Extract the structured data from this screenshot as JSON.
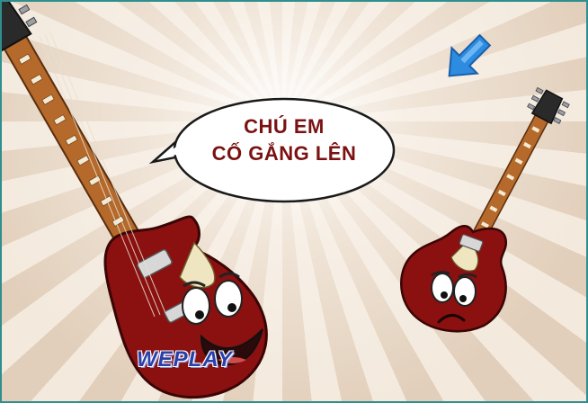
{
  "speech_bubble": {
    "line1": "CHÚ EM",
    "line2": "CỐ GẮNG LÊN"
  },
  "logo": {
    "text": "WEPLAY"
  },
  "icons": {
    "hint_arrow": "arrow-down-right-icon",
    "big_guitar": "smiling-guitar-character",
    "small_guitar": "sad-guitar-character"
  },
  "colors": {
    "guitar_body": "#8b1010",
    "neck": "#b5692a",
    "arrow": "#2d8be0",
    "bubble_text": "#7a1212",
    "logo_text": "#2b3fa8"
  }
}
